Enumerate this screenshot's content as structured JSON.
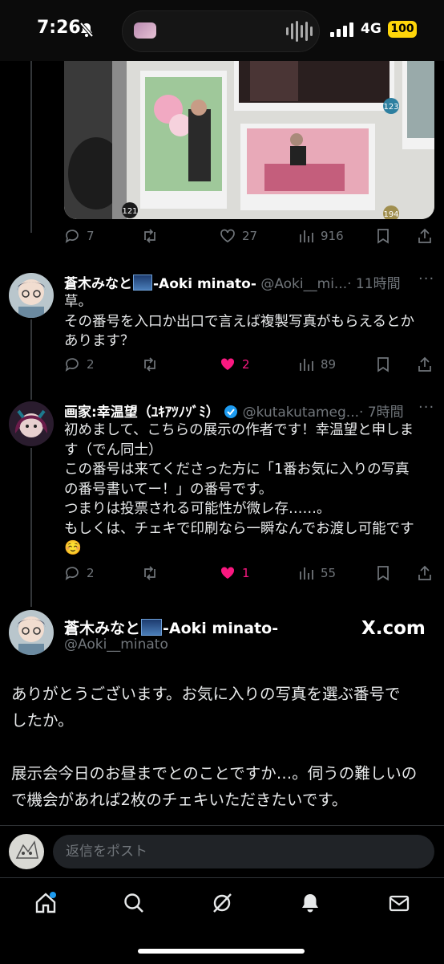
{
  "status_bar": {
    "time": "7:26",
    "network": "4G",
    "battery": "100"
  },
  "photo": {
    "tag_left": "121",
    "tag_mid": "123",
    "tag_right": "194"
  },
  "post0_actions": {
    "replies": "7",
    "reposts": "",
    "likes": "27",
    "views": "916"
  },
  "post1": {
    "name": "蒼木みなと",
    "name_suffix": "-Aoki minato-",
    "handle": "@Aoki__mi...",
    "time": "· 11時間",
    "text_lines": [
      "草。",
      "その番号を入口か出口で言えば複製写真がもらえるとか",
      "あります？"
    ],
    "replies": "2",
    "likes": "2",
    "views": "89"
  },
  "post2": {
    "name": "画家:幸温望（ﾕｷｱﾂﾉｿﾞﾐ）",
    "handle": "@kutakutameg...",
    "time": "· 7時間",
    "text_lines": [
      "初めまして、こちらの展示の作者です！幸温望と申しま",
      "す（でん同士）",
      "この番号は来てくださった方に「1番お気に入りの写真",
      "の番号書いてー！」の番号です。",
      "つまりは投票される可能性が微レ存……。",
      "もしくは、チェキで印刷なら一瞬なんでお渡し可能です"
    ],
    "emoji": "☺️",
    "replies": "2",
    "likes": "1",
    "views": "55"
  },
  "post3": {
    "name": "蒼木みなと",
    "name_suffix": "-Aoki minato-",
    "handle": "@Aoki__minato",
    "brand": "X.com",
    "paragraph1": [
      "ありがとうございます。お気に入りの写真を選ぶ番号で",
      "したか。"
    ],
    "paragraph2": [
      "展示会今日のお昼までとのことですか…。伺うの難しいの",
      "で機会があれば2枚のチェキいただきたいです。"
    ]
  },
  "reply_bar": {
    "placeholder": "返信をポスト"
  },
  "tabs": [
    "home",
    "search",
    "grok",
    "notifications",
    "messages"
  ],
  "colors": {
    "like": "#f91880",
    "accent": "#1d9bf0",
    "muted": "#71767b"
  }
}
